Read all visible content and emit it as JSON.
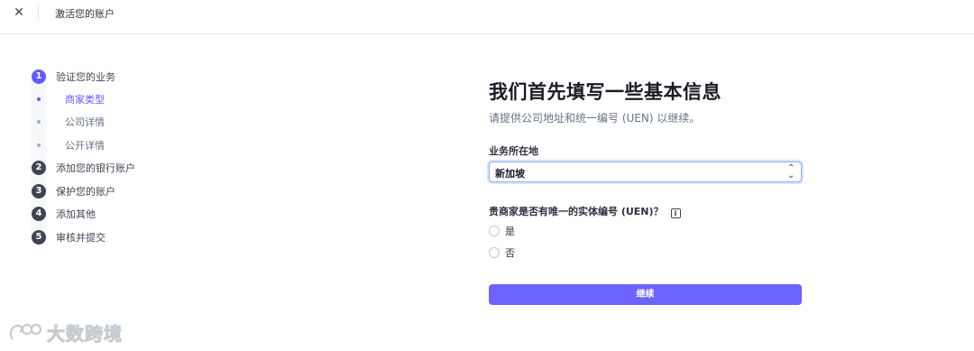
{
  "header": {
    "close_icon": "close-icon",
    "title": "激活您的账户"
  },
  "stepper": {
    "steps": [
      {
        "num": "1",
        "label": "验证您的业务",
        "active": true
      },
      {
        "num": "2",
        "label": "添加您的银行账户"
      },
      {
        "num": "3",
        "label": "保护您的账户"
      },
      {
        "num": "4",
        "label": "添加其他"
      },
      {
        "num": "5",
        "label": "审核并提交"
      }
    ],
    "substeps": [
      {
        "label": "商家类型",
        "active": true
      },
      {
        "label": "公司详情"
      },
      {
        "label": "公开详情"
      }
    ]
  },
  "main": {
    "heading": "我们首先填写一些基本信息",
    "subheading": "请提供公司地址和统一编号 (UEN) 以继续。",
    "location_label": "业务所在地",
    "location_value": "新加坡",
    "uen_question": "贵商家是否有唯一的实体编号 (UEN)？",
    "options": [
      "是",
      "否"
    ],
    "continue_label": "继续"
  },
  "watermark": {
    "text": "大数跨境"
  },
  "colors": {
    "accent": "#635bff",
    "button": "#6c63ff"
  }
}
